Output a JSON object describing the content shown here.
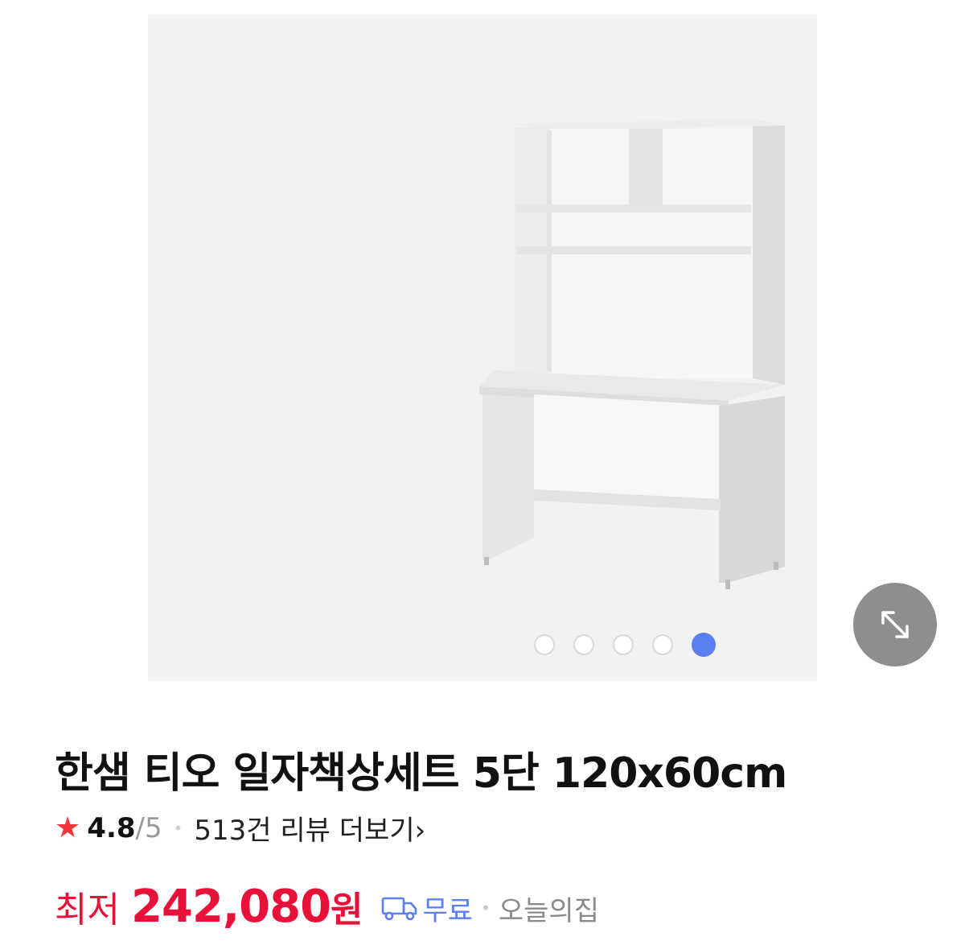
{
  "gallery": {
    "slide_count": 5,
    "active_slide": 5,
    "dot_colors": {
      "active": "#5b7ef0",
      "inactive": "#d9d9d9"
    },
    "expand_icon": "expand-diagonal-icon",
    "background": "#f2f2f2"
  },
  "product": {
    "title": "한샘 티오 일자책상세트 5단 120x60cm"
  },
  "rating": {
    "star_icon": "star-icon",
    "score": "4.8",
    "max": "/5",
    "separator": "•",
    "review_text": "513건 리뷰 더보기",
    "chevron": "›"
  },
  "price": {
    "label": "최저",
    "amount": "242,080",
    "unit": "원",
    "accent": "#e8113a"
  },
  "shipping": {
    "truck_icon": "delivery-truck-icon",
    "label": "무료",
    "separator": "•",
    "seller": "오늘의집",
    "accent": "#5b7ef0"
  }
}
